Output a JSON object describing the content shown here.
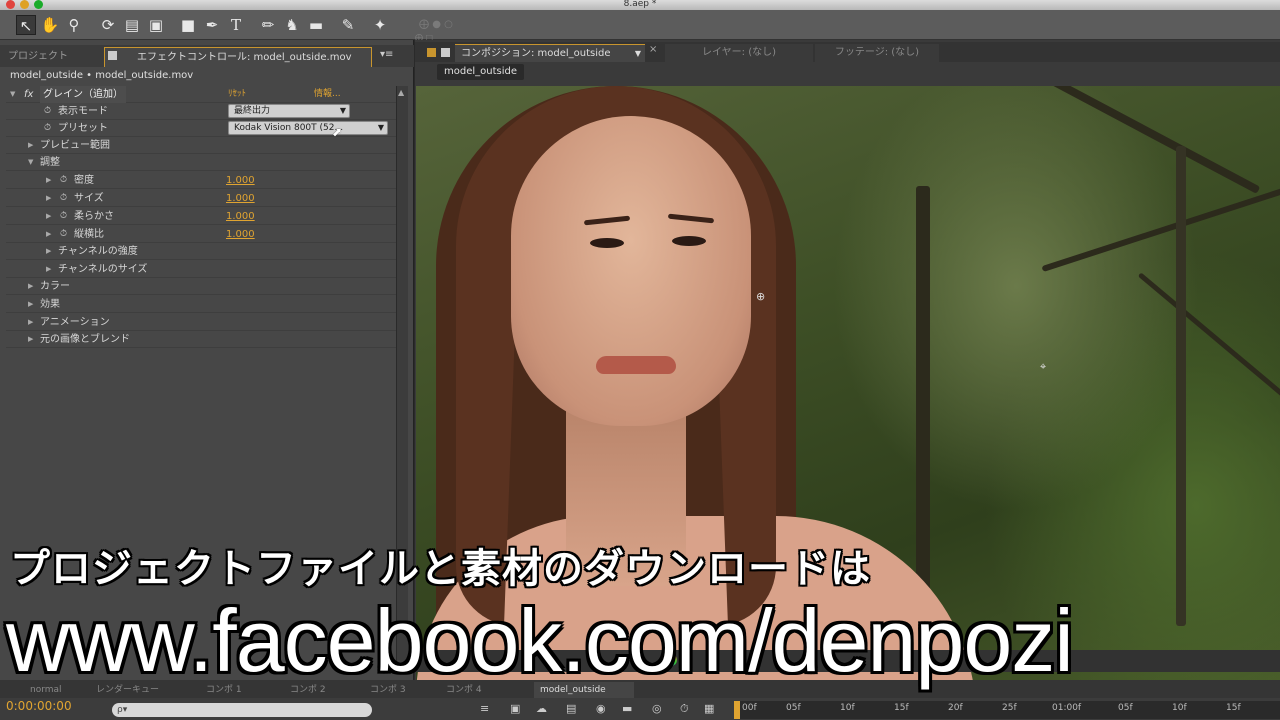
{
  "window": {
    "title": "8.aep *"
  },
  "toolbar": {
    "tools": [
      "selection-tool",
      "hand-tool",
      "zoom-tool",
      "rotation-tool",
      "camera-tool",
      "pan-behind-tool",
      "rectangle-tool",
      "pen-tool",
      "type-tool",
      "brush-tool",
      "clone-stamp-tool",
      "eraser-tool",
      "roto-brush-tool",
      "puppet-pin-tool"
    ]
  },
  "left_panel": {
    "tab_project": "プロジェクト",
    "tab_effect_controls": "エフェクトコントロール: model_outside.mov",
    "layer_path": "model_outside • model_outside.mov",
    "effect": {
      "fx_label": "fx",
      "name": "グレイン（追加）",
      "reset": "ﾘｾｯﾄ",
      "about": "情報..."
    },
    "rows": {
      "display_mode_label": "表示モード",
      "display_mode_value": "最終出力",
      "preset_label": "プリセット",
      "preset_value": "Kodak Vision 800T (52...",
      "preview_region": "プレビュー範囲",
      "adjust": "調整",
      "density_label": "密度",
      "density_value": "1.000",
      "size_label": "サイズ",
      "size_value": "1.000",
      "softness_label": "柔らかさ",
      "softness_value": "1.000",
      "aspect_label": "縦横比",
      "aspect_value": "1.000",
      "channel_intensity": "チャンネルの強度",
      "channel_size": "チャンネルのサイズ",
      "color": "カラー",
      "effect_section": "効果",
      "animation": "アニメーション",
      "blend": "元の画像とブレンド"
    }
  },
  "comp_panel": {
    "tab_composition": "コンポジション: model_outside",
    "tab_layer": "レイヤー: (なし)",
    "tab_footage": "フッテージ: (なし)",
    "sub_tab": "model_outside"
  },
  "timeline": {
    "tabs": [
      "normal",
      "レンダーキュー",
      "コンポ 1",
      "コンポ 2",
      "コンポ 3",
      "コンポ 4",
      "model_outside"
    ],
    "timecode": "0:00:00:00",
    "search_placeholder": "ρ▾",
    "ruler": [
      "00f",
      "05f",
      "10f",
      "15f",
      "20f",
      "25f",
      "01:00f",
      "05f",
      "10f",
      "15f"
    ]
  },
  "overlay": {
    "jp_text": "プロジェクトファイルと素材のダウンロードは",
    "url_text": "www.facebook.com/denpozi"
  },
  "colors": {
    "accent": "#e0a431",
    "panel": "#474747"
  }
}
